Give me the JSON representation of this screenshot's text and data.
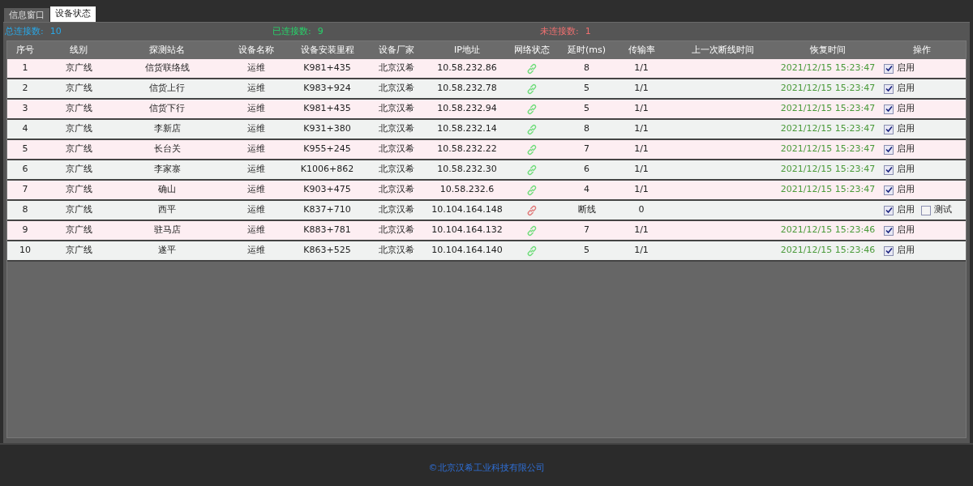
{
  "tabs": [
    {
      "label": "信息窗口",
      "selected": false
    },
    {
      "label": "设备状态",
      "selected": true
    }
  ],
  "summary": [
    {
      "label": "总连接数:",
      "value": "10",
      "color": "#2aa7e6"
    },
    {
      "label": "已连接数:",
      "value": "9",
      "color": "#27d36a"
    },
    {
      "label": "未连接数:",
      "value": "1",
      "color": "#f07070"
    }
  ],
  "table": {
    "columns": [
      "序号",
      "线别",
      "探测站名",
      "设备名称",
      "设备安装里程",
      "设备厂家",
      "IP地址",
      "网络状态",
      "延时(ms)",
      "传输率",
      "上一次断线时间",
      "恢复时间",
      "操作"
    ],
    "rows": [
      {
        "no": "1",
        "line": "京广线",
        "station": "信货联络线",
        "device": "运维",
        "mileage": "K981+435",
        "vendor": "北京汉希",
        "ip": "10.58.232.86",
        "connected": true,
        "delay": "8",
        "rate": "1/1",
        "recovered": "2021/12/15 15:23:47",
        "actions": [
          {
            "label": "启用",
            "checked": true
          }
        ]
      },
      {
        "no": "2",
        "line": "京广线",
        "station": "信货上行",
        "device": "运维",
        "mileage": "K983+924",
        "vendor": "北京汉希",
        "ip": "10.58.232.78",
        "connected": true,
        "delay": "5",
        "rate": "1/1",
        "recovered": "2021/12/15 15:23:47",
        "actions": [
          {
            "label": "启用",
            "checked": true
          }
        ]
      },
      {
        "no": "3",
        "line": "京广线",
        "station": "信货下行",
        "device": "运维",
        "mileage": "K981+435",
        "vendor": "北京汉希",
        "ip": "10.58.232.94",
        "connected": true,
        "delay": "5",
        "rate": "1/1",
        "recovered": "2021/12/15 15:23:47",
        "actions": [
          {
            "label": "启用",
            "checked": true
          }
        ]
      },
      {
        "no": "4",
        "line": "京广线",
        "station": "李新店",
        "device": "运维",
        "mileage": "K931+380",
        "vendor": "北京汉希",
        "ip": "10.58.232.14",
        "connected": true,
        "delay": "8",
        "rate": "1/1",
        "recovered": "2021/12/15 15:23:47",
        "actions": [
          {
            "label": "启用",
            "checked": true
          }
        ]
      },
      {
        "no": "5",
        "line": "京广线",
        "station": "长台关",
        "device": "运维",
        "mileage": "K955+245",
        "vendor": "北京汉希",
        "ip": "10.58.232.22",
        "connected": true,
        "delay": "7",
        "rate": "1/1",
        "recovered": "2021/12/15 15:23:47",
        "actions": [
          {
            "label": "启用",
            "checked": true
          }
        ]
      },
      {
        "no": "6",
        "line": "京广线",
        "station": "李家寨",
        "device": "运维",
        "mileage": "K1006+862",
        "vendor": "北京汉希",
        "ip": "10.58.232.30",
        "connected": true,
        "delay": "6",
        "rate": "1/1",
        "recovered": "2021/12/15 15:23:47",
        "actions": [
          {
            "label": "启用",
            "checked": true
          }
        ]
      },
      {
        "no": "7",
        "line": "京广线",
        "station": "确山",
        "device": "运维",
        "mileage": "K903+475",
        "vendor": "北京汉希",
        "ip": "10.58.232.6",
        "connected": true,
        "delay": "4",
        "rate": "1/1",
        "recovered": "2021/12/15 15:23:47",
        "actions": [
          {
            "label": "启用",
            "checked": true
          }
        ]
      },
      {
        "no": "8",
        "line": "京广线",
        "station": "西平",
        "device": "运维",
        "mileage": "K837+710",
        "vendor": "北京汉希",
        "ip": "10.104.164.148",
        "connected": false,
        "delay": "断线",
        "rate": "0",
        "actions": [
          {
            "label": "启用",
            "checked": true
          },
          {
            "label": "测试",
            "checked": false
          }
        ]
      },
      {
        "no": "9",
        "line": "京广线",
        "station": "驻马店",
        "device": "运维",
        "mileage": "K883+781",
        "vendor": "北京汉希",
        "ip": "10.104.164.132",
        "connected": true,
        "delay": "7",
        "rate": "1/1",
        "recovered": "2021/12/15 15:23:46",
        "actions": [
          {
            "label": "启用",
            "checked": true
          }
        ]
      },
      {
        "no": "10",
        "line": "京广线",
        "station": "遂平",
        "device": "运维",
        "mileage": "K863+525",
        "vendor": "北京汉希",
        "ip": "10.104.164.140",
        "connected": true,
        "delay": "5",
        "rate": "1/1",
        "recovered": "2021/12/15 15:23:46",
        "actions": [
          {
            "label": "启用",
            "checked": true
          }
        ]
      }
    ]
  },
  "footer": "©北京汉希工业科技有限公司"
}
